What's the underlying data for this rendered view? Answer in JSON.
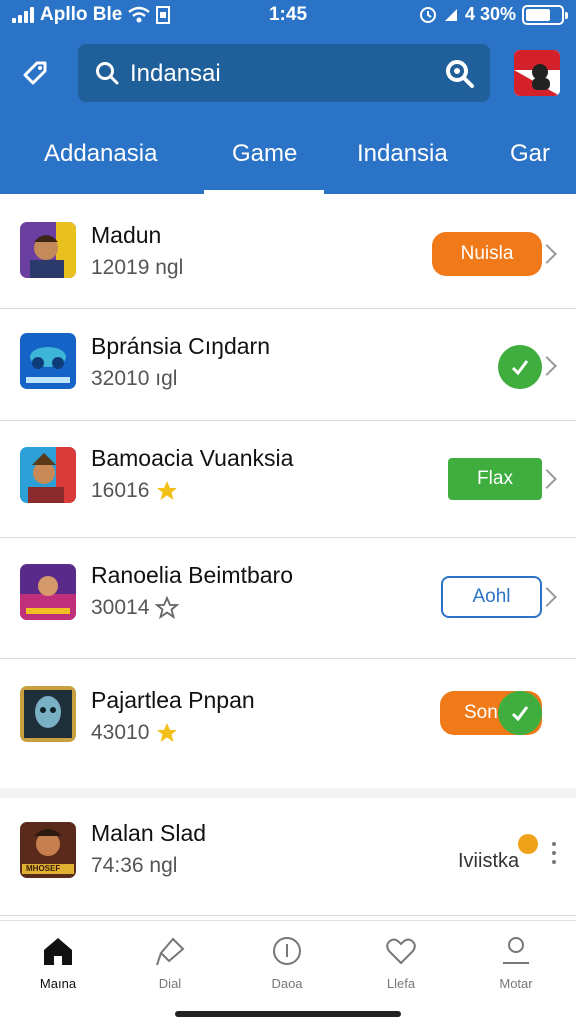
{
  "status_bar": {
    "carrier": "Apllo Ble",
    "time": "1:45",
    "battery": "4 30%"
  },
  "header": {
    "search_query": "Indansai"
  },
  "tabs": [
    {
      "label": "Addanasia"
    },
    {
      "label": "Game"
    },
    {
      "label": "Indansia"
    },
    {
      "label": "Gar"
    }
  ],
  "apps": [
    {
      "title": "Madun",
      "meta": "12019 ngl",
      "action": "Nuisla",
      "action_style": "orange-pill"
    },
    {
      "title": "Bpránsia Cıŋdarn",
      "meta": "32010 ıgl",
      "action": "",
      "action_style": "green-circle"
    },
    {
      "title": "Bamoacia Vuanksia",
      "meta": "16016",
      "action": "Flax",
      "action_style": "green-pill"
    },
    {
      "title": "Ranoelia Beimtbaro",
      "meta": "30014",
      "action": "Aohl",
      "action_style": "outline-pill"
    },
    {
      "title": "Pajartlea Pnpan",
      "meta": "43010",
      "action": "Son",
      "action_style": "orange-pill-check"
    },
    {
      "title": "Malan Slad",
      "meta": "74:36 ngl",
      "action": "Iviistka",
      "action_style": "text-more"
    }
  ],
  "icon_labels": {
    "app6_badge": "MHOSEF"
  },
  "bottom_nav": [
    {
      "label": "Maına",
      "icon": "home-icon"
    },
    {
      "label": "Dial",
      "icon": "pin-icon"
    },
    {
      "label": "Daoa",
      "icon": "info-icon"
    },
    {
      "label": "Llefa",
      "icon": "heart-icon"
    },
    {
      "label": "Motar",
      "icon": "profile-icon"
    }
  ],
  "colors": {
    "header_blue": "#2b73c6",
    "search_field": "#1f5f9a",
    "orange": "#f07a1a",
    "green": "#3fae3f"
  }
}
